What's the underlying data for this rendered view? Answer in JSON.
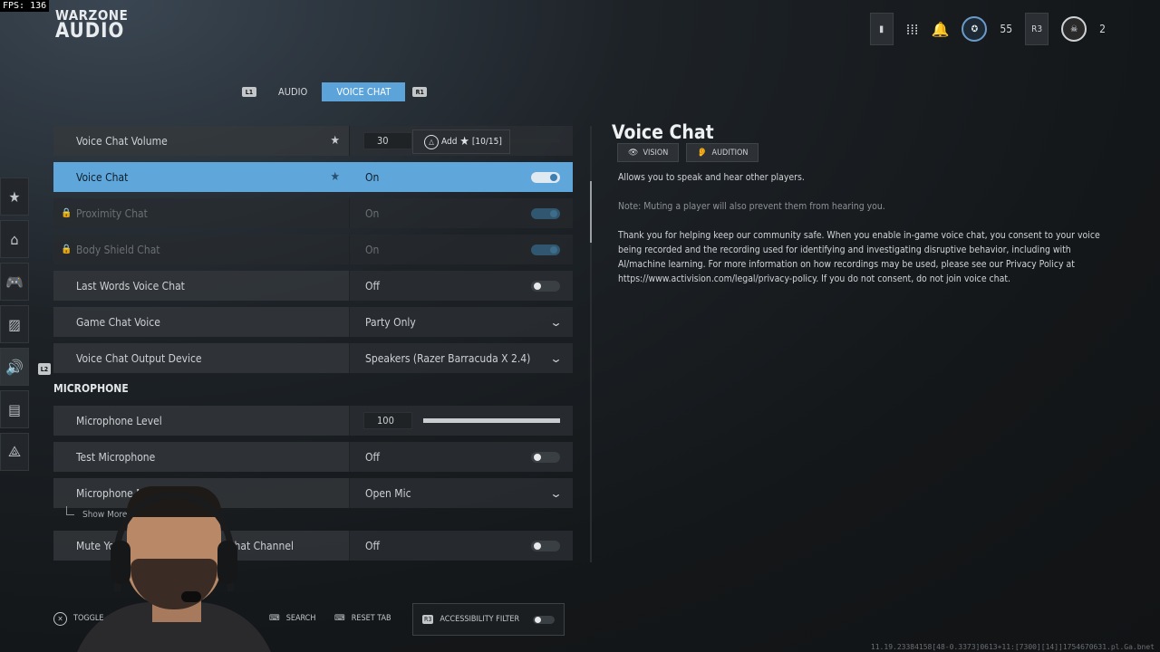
{
  "overlay": {
    "fps": "FPS: 136"
  },
  "brand": {
    "line1": "WARZONE",
    "line2": "AUDIO"
  },
  "topbar": {
    "bumper_r3": "R3",
    "level": "55",
    "prestige_count": "2"
  },
  "tabs": {
    "left_bumper": "L1",
    "right_bumper": "R1",
    "items": [
      {
        "label": "AUDIO",
        "active": false
      },
      {
        "label": "VOICE CHAT",
        "active": true
      }
    ]
  },
  "side_nav_tag": "L2",
  "settings": {
    "voice_chat_volume": {
      "label": "Voice Chat Volume",
      "value": "30",
      "level_percent": 30
    },
    "voice_chat": {
      "label": "Voice Chat",
      "value": "On"
    },
    "proximity_chat": {
      "label": "Proximity Chat",
      "value": "On"
    },
    "body_shield_chat": {
      "label": "Body Shield Chat",
      "value": "On"
    },
    "last_words": {
      "label": "Last Words Voice Chat",
      "value": "Off"
    },
    "game_chat_voice": {
      "label": "Game Chat Voice",
      "value": "Party Only"
    },
    "output_device": {
      "label": "Voice Chat Output Device",
      "value": "Speakers (Razer Barracuda X 2.4)"
    },
    "microphone_section": "MICROPHONE",
    "microphone_level": {
      "label": "Microphone Level",
      "value": "100",
      "level_percent": 100
    },
    "test_microphone": {
      "label": "Test Microphone",
      "value": "Off"
    },
    "microphone_mode": {
      "label": "Microphone Mo",
      "value": "Open Mic"
    },
    "show_more": "Show More",
    "mute_channel": {
      "label_start": "Mute Yo",
      "label_end": "Chat Channel",
      "value": "Off"
    }
  },
  "tooltip": {
    "button": "△",
    "text": "Add",
    "count": "[10/15]"
  },
  "detail": {
    "title": "Voice Chat",
    "chips": [
      "VISION",
      "AUDITION"
    ],
    "description": "Allows you to speak and hear other players.",
    "note": "Note: Muting a player will also prevent them from hearing you.",
    "long_text": "Thank you for helping keep our community safe. When you enable in-game voice chat, you consent to your voice being recorded and the recording used for identifying and investigating disruptive behavior, including with AI/machine learning. For more information on how recordings may be used, please see our Privacy Policy at https://www.activision.com/legal/privacy-policy. If you do not consent, do not join voice chat."
  },
  "bottom_bar": {
    "toggle": "TOGGLE",
    "search": "SEARCH",
    "reset": "RESET TAB",
    "accessibility": "ACCESSIBILITY FILTER",
    "r3_tag": "R3"
  },
  "build_string": "11.19.23384158[48-0.3373]0613+11:[7300][14]]1754670631.pl.Ga.bnet"
}
